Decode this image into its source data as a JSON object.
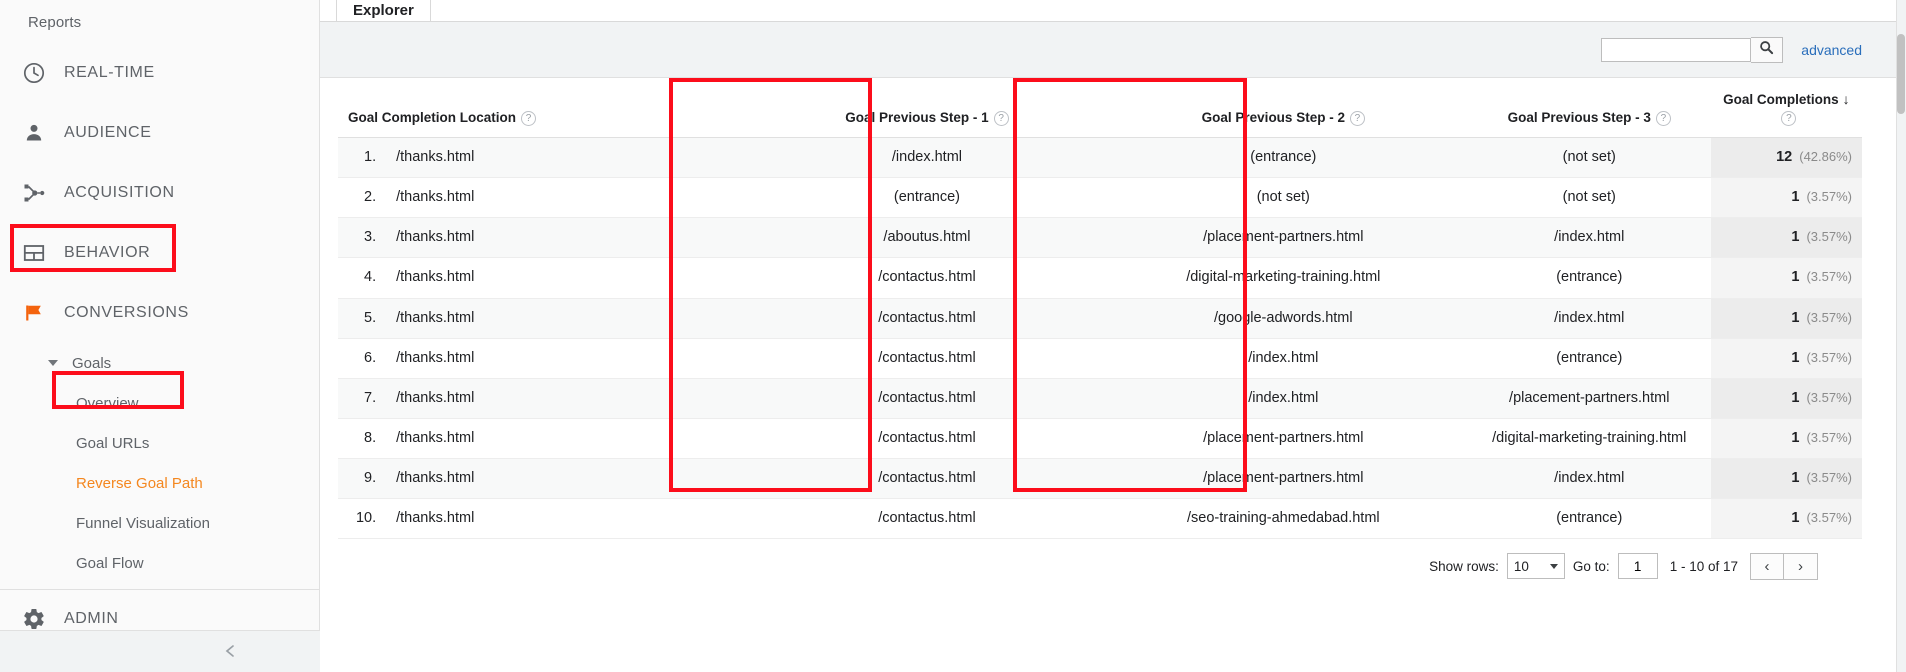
{
  "sidebar": {
    "reports_label": "Reports",
    "nav": [
      {
        "label": "REAL-TIME",
        "icon": "clock-icon"
      },
      {
        "label": "AUDIENCE",
        "icon": "person-icon"
      },
      {
        "label": "ACQUISITION",
        "icon": "acquisition-icon"
      },
      {
        "label": "BEHAVIOR",
        "icon": "behavior-icon"
      },
      {
        "label": "CONVERSIONS",
        "icon": "flag-icon"
      }
    ],
    "goals_group": "Goals",
    "goal_items": [
      {
        "label": "Overview",
        "active": false
      },
      {
        "label": "Goal URLs",
        "active": false
      },
      {
        "label": "Reverse Goal Path",
        "active": true
      },
      {
        "label": "Funnel Visualization",
        "active": false
      },
      {
        "label": "Goal Flow",
        "active": false
      }
    ],
    "admin_label": "ADMIN",
    "admin_icon": "gear-icon"
  },
  "main": {
    "tabs": [
      {
        "label": "Explorer",
        "active": true
      }
    ],
    "search": {
      "value": "",
      "placeholder": "",
      "icon": "search-icon"
    },
    "advanced_label": "advanced"
  },
  "table": {
    "headers": [
      {
        "label": "Goal Completion Location",
        "help": "?",
        "align": "left"
      },
      {
        "label": "Goal Previous Step - 1",
        "help": "?",
        "align": "center"
      },
      {
        "label": "Goal Previous Step - 2",
        "help": "?",
        "align": "center"
      },
      {
        "label": "Goal Previous Step - 3",
        "help": "?",
        "align": "center"
      },
      {
        "label": "Goal Completions",
        "help": "?",
        "align": "right",
        "sort": "↓"
      }
    ],
    "rows": [
      {
        "idx": "1.",
        "loc": "/thanks.html",
        "s1": "/index.html",
        "s2": "(entrance)",
        "s3": "(not set)",
        "num": "12",
        "pct": "(42.86%)"
      },
      {
        "idx": "2.",
        "loc": "/thanks.html",
        "s1": "(entrance)",
        "s2": "(not set)",
        "s3": "(not set)",
        "num": "1",
        "pct": "(3.57%)"
      },
      {
        "idx": "3.",
        "loc": "/thanks.html",
        "s1": "/aboutus.html",
        "s2": "/placement-partners.html",
        "s3": "/index.html",
        "num": "1",
        "pct": "(3.57%)"
      },
      {
        "idx": "4.",
        "loc": "/thanks.html",
        "s1": "/contactus.html",
        "s2": "/digital-marketing-training.html",
        "s3": "(entrance)",
        "num": "1",
        "pct": "(3.57%)"
      },
      {
        "idx": "5.",
        "loc": "/thanks.html",
        "s1": "/contactus.html",
        "s2": "/google-adwords.html",
        "s3": "/index.html",
        "num": "1",
        "pct": "(3.57%)"
      },
      {
        "idx": "6.",
        "loc": "/thanks.html",
        "s1": "/contactus.html",
        "s2": "/index.html",
        "s3": "(entrance)",
        "num": "1",
        "pct": "(3.57%)"
      },
      {
        "idx": "7.",
        "loc": "/thanks.html",
        "s1": "/contactus.html",
        "s2": "/index.html",
        "s3": "/placement-partners.html",
        "num": "1",
        "pct": "(3.57%)"
      },
      {
        "idx": "8.",
        "loc": "/thanks.html",
        "s1": "/contactus.html",
        "s2": "/placement-partners.html",
        "s3": "/digital-marketing-training.html",
        "num": "1",
        "pct": "(3.57%)"
      },
      {
        "idx": "9.",
        "loc": "/thanks.html",
        "s1": "/contactus.html",
        "s2": "/placement-partners.html",
        "s3": "/index.html",
        "num": "1",
        "pct": "(3.57%)"
      },
      {
        "idx": "10.",
        "loc": "/thanks.html",
        "s1": "/contactus.html",
        "s2": "/seo-training-ahmedabad.html",
        "s3": "(entrance)",
        "num": "1",
        "pct": "(3.57%)"
      }
    ]
  },
  "pager": {
    "show_rows_label": "Show rows:",
    "rows_value": "10",
    "goto_label": "Go to:",
    "goto_value": "1",
    "range": "1 - 10 of 17",
    "prev_icon": "‹",
    "next_icon": "›"
  },
  "colors": {
    "accent_orange": "#f4871f",
    "highlight_red": "#fc0d1b",
    "link_blue": "#2a6ebb",
    "text_gray": "#5f6368"
  }
}
